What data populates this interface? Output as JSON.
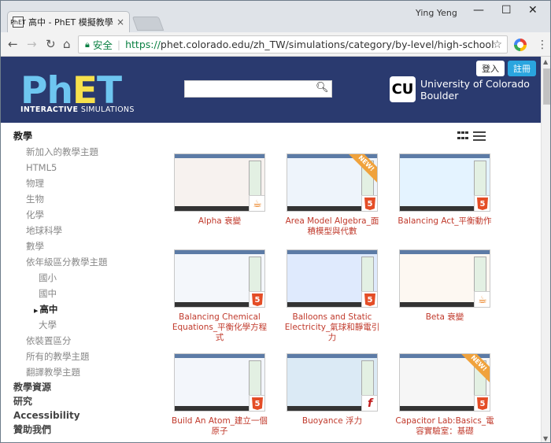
{
  "browser": {
    "tab_title": "高中 - PhET 模擬教學",
    "tab_close": "×",
    "favicon": "PhET",
    "user_name": "Ying Yeng",
    "secure_label": "安全",
    "url_scheme": "https://",
    "url_rest": "phet.colorado.edu/zh_TW/simulations/category/by-level/high-school"
  },
  "header": {
    "logo_ph": "Ph",
    "logo_e": "E",
    "logo_t": "T",
    "logo_sub_bold": "INTERACTIVE",
    "logo_sub": "SIMULATIONS",
    "search_placeholder": "",
    "university_line1": "University of Colorado",
    "university_line2": "Boulder",
    "login_label": "登入",
    "register_label": "註冊"
  },
  "sidebar": {
    "teaching_heading": "教學",
    "items": [
      "新加入的教學主題",
      "HTML5",
      "物理",
      "生物",
      "化學",
      "地球科學",
      "數學",
      "依年級區分教學主題"
    ],
    "levels": [
      "國小",
      "國中",
      "高中",
      "大學"
    ],
    "active_level": "高中",
    "items_after": [
      "依裝置區分",
      "所有的教學主題",
      "翻譯教學主題"
    ],
    "bottom": [
      "教學資源",
      "研究",
      "Accessibility",
      "贊助我們"
    ]
  },
  "simulations": [
    {
      "title": "Alpha 衰變",
      "tech": "java",
      "new": false
    },
    {
      "title": "Area Model Algebra_面積模型與代數",
      "tech": "html5",
      "new": true
    },
    {
      "title": "Balancing Act_平衡動作",
      "tech": "html5",
      "new": false
    },
    {
      "title": "Balancing Chemical Equations_平衡化學方程式",
      "tech": "html5",
      "new": false
    },
    {
      "title": "Balloons and Static Electricity_氣球和靜電引力",
      "tech": "html5",
      "new": false
    },
    {
      "title": "Beta 衰變",
      "tech": "java",
      "new": false
    },
    {
      "title": "Build An Atom_建立一個原子",
      "tech": "html5",
      "new": false
    },
    {
      "title": "Buoyance 浮力",
      "tech": "flash",
      "new": false
    },
    {
      "title": "Capacitor Lab:Basics_電容實驗室：基礎",
      "tech": "html5",
      "new": true
    }
  ],
  "badges": {
    "html5": "5",
    "java": "☕",
    "flash": "f",
    "new": "NEW!"
  },
  "colors": {
    "header_bg": "#2a3a6f",
    "title_red": "#c0392b",
    "register_blue": "#2aa5df"
  }
}
